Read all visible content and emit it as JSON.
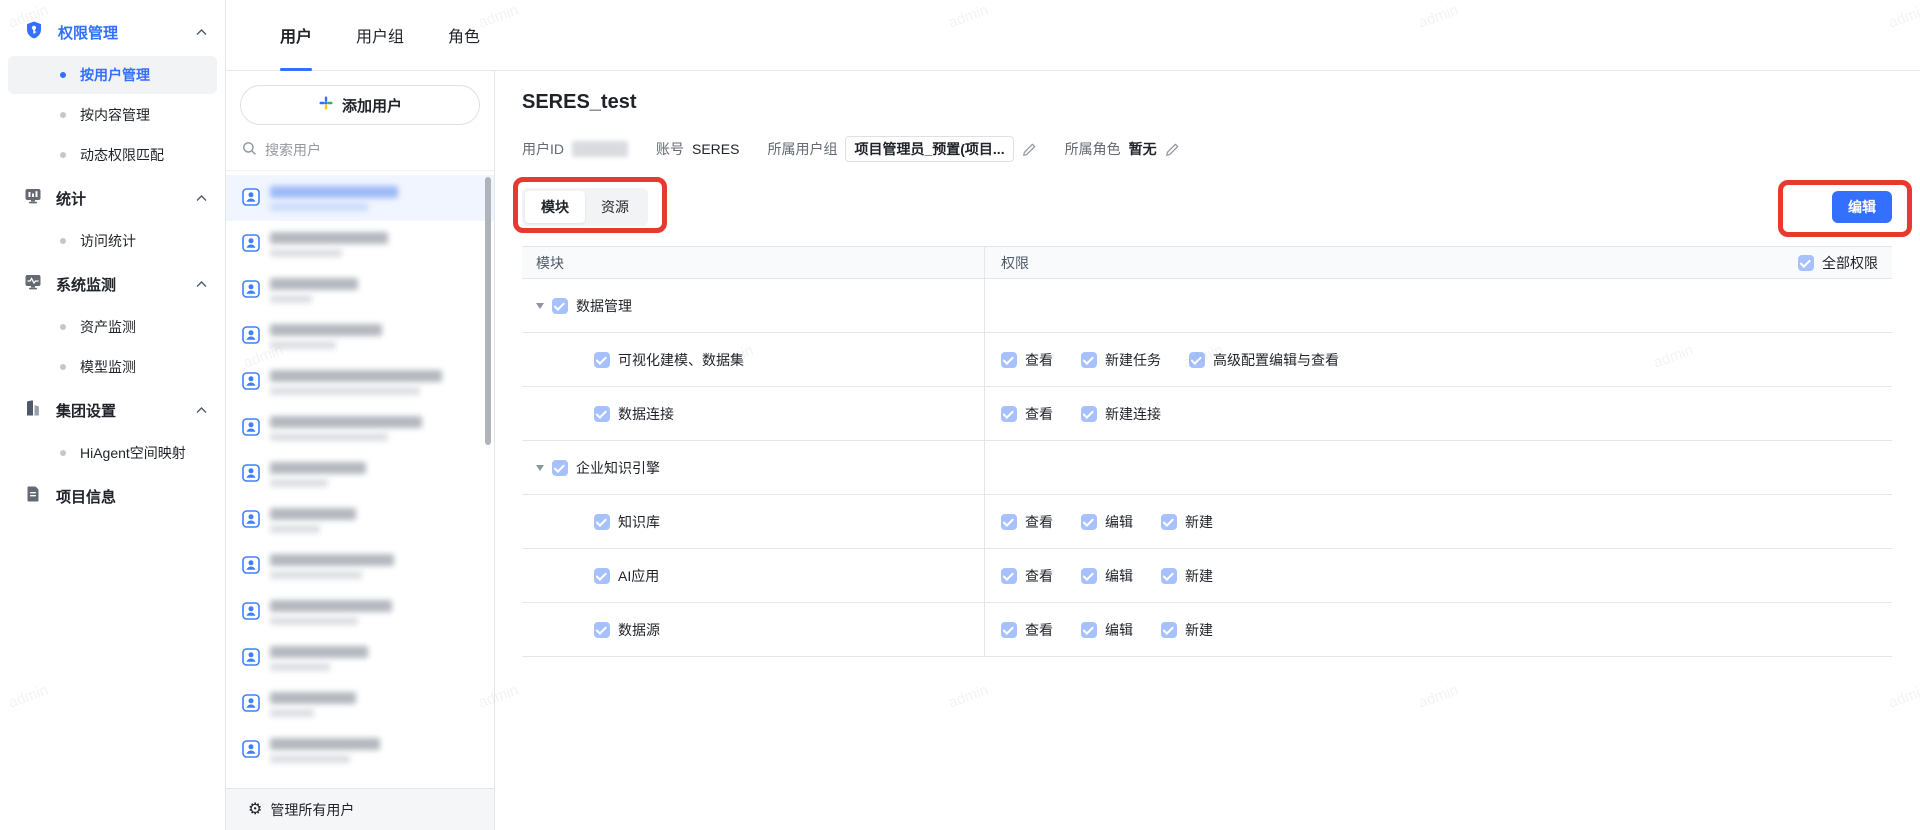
{
  "watermark": {
    "text": "admin"
  },
  "colors": {
    "primary": "#3370ff",
    "annotation_red": "#e8392e",
    "checkbox_checked": "#a6c1fb"
  },
  "sidebar": {
    "sections": [
      {
        "label": "权限管理",
        "children": [
          "按用户管理",
          "按内容管理",
          "动态权限匹配"
        ]
      },
      {
        "label": "统计",
        "children": [
          "访问统计"
        ]
      },
      {
        "label": "系统监测",
        "children": [
          "资产监测",
          "模型监测"
        ]
      },
      {
        "label": "集团设置",
        "children": [
          "HiAgent空间映射"
        ]
      },
      {
        "label": "项目信息",
        "children": []
      }
    ],
    "active_item": "按用户管理"
  },
  "tabbar": {
    "tabs": [
      "用户",
      "用户组",
      "角色"
    ],
    "active": "用户"
  },
  "userPanel": {
    "addUserLabel": "添加用户",
    "searchPlaceholder": "搜索用户",
    "manageAllLabel": "管理所有用户"
  },
  "detail": {
    "title": "SERES_test",
    "meta": {
      "userIdLabel": "用户ID",
      "accountLabel": "账号",
      "accountValue": "SERES",
      "groupLabel": "所属用户组",
      "groupValue": "项目管理员_预置(项目...",
      "roleLabel": "所属角色",
      "roleValue": "暂无"
    },
    "viewTabs": {
      "module": "模块",
      "resource": "资源",
      "active": "模块"
    },
    "editButtonLabel": "编辑",
    "table": {
      "moduleHeader": "模块",
      "permHeader": "权限",
      "allPermsLabel": "全部权限",
      "rows": [
        {
          "type": "group",
          "module": "数据管理",
          "checked": true,
          "perms": []
        },
        {
          "type": "child",
          "module": "可视化建模、数据集",
          "checked": true,
          "perms": [
            "查看",
            "新建任务",
            "高级配置编辑与查看"
          ]
        },
        {
          "type": "child",
          "module": "数据连接",
          "checked": true,
          "perms": [
            "查看",
            "新建连接"
          ]
        },
        {
          "type": "group",
          "module": "企业知识引擎",
          "checked": true,
          "perms": []
        },
        {
          "type": "child",
          "module": "知识库",
          "checked": true,
          "perms": [
            "查看",
            "编辑",
            "新建"
          ]
        },
        {
          "type": "child",
          "module": "AI应用",
          "checked": true,
          "perms": [
            "查看",
            "编辑",
            "新建"
          ]
        },
        {
          "type": "child",
          "module": "数据源",
          "checked": true,
          "perms": [
            "查看",
            "编辑",
            "新建"
          ]
        }
      ]
    }
  }
}
